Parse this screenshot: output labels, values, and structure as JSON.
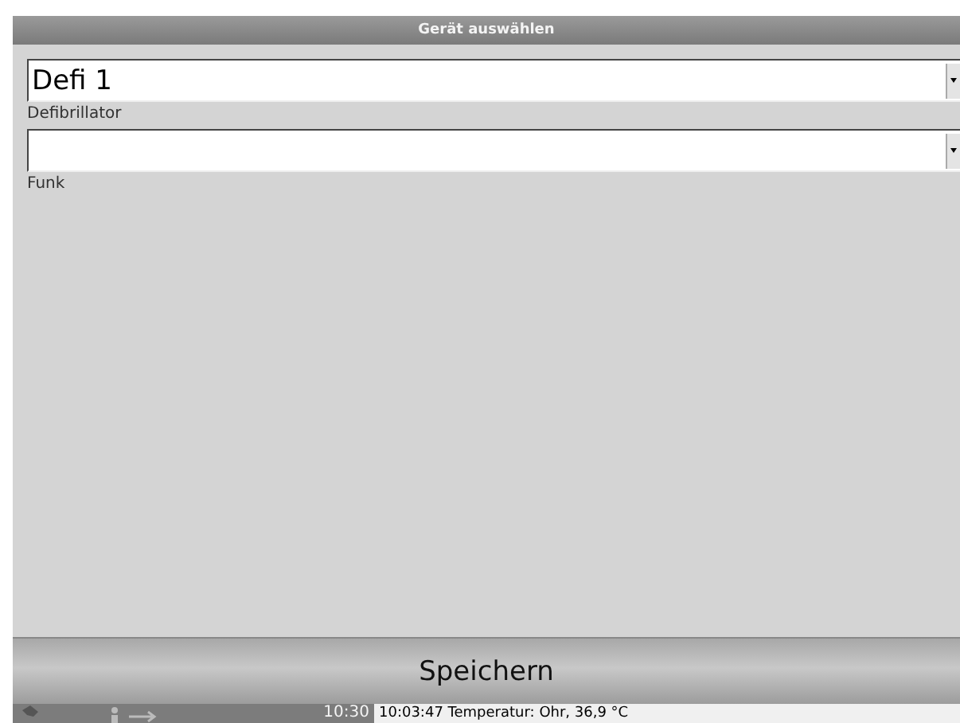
{
  "window": {
    "title": "Gerät auswählen"
  },
  "fields": [
    {
      "value": "Defi 1",
      "label": "Defibrillator"
    },
    {
      "label": "Funk"
    }
  ],
  "save_button": {
    "label": "Speichern"
  },
  "status_bar": {
    "time": "10:30",
    "message": "10:03:47 Temperatur: Ohr, 36,9 °C"
  }
}
